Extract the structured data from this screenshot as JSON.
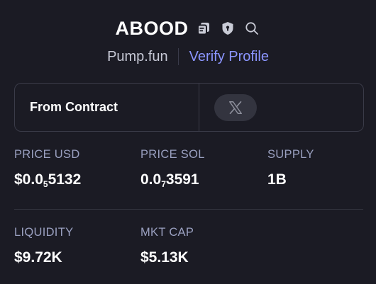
{
  "header": {
    "token_name": "ABOOD",
    "source": "Pump.fun",
    "verify_label": "Verify Profile",
    "icons": [
      "copy-icon",
      "shield-icon",
      "search-icon"
    ]
  },
  "contract": {
    "label": "From Contract",
    "social_icon": "x-logo-icon"
  },
  "stats": {
    "price_usd": {
      "label": "PRICE USD",
      "prefix": "$0.0",
      "zeros": "5",
      "suffix": "5132"
    },
    "price_sol": {
      "label": "PRICE SOL",
      "prefix": "0.0",
      "zeros": "7",
      "suffix": "3591"
    },
    "supply": {
      "label": "SUPPLY",
      "value": "1B"
    },
    "liquidity": {
      "label": "LIQUIDITY",
      "value": "$9.72K"
    },
    "mkt_cap": {
      "label": "MKT CAP",
      "value": "$5.13K"
    }
  },
  "colors": {
    "background": "#1b1b24",
    "accent": "#8b95ff",
    "label": "#9aa0c0",
    "value": "#ffffff"
  }
}
